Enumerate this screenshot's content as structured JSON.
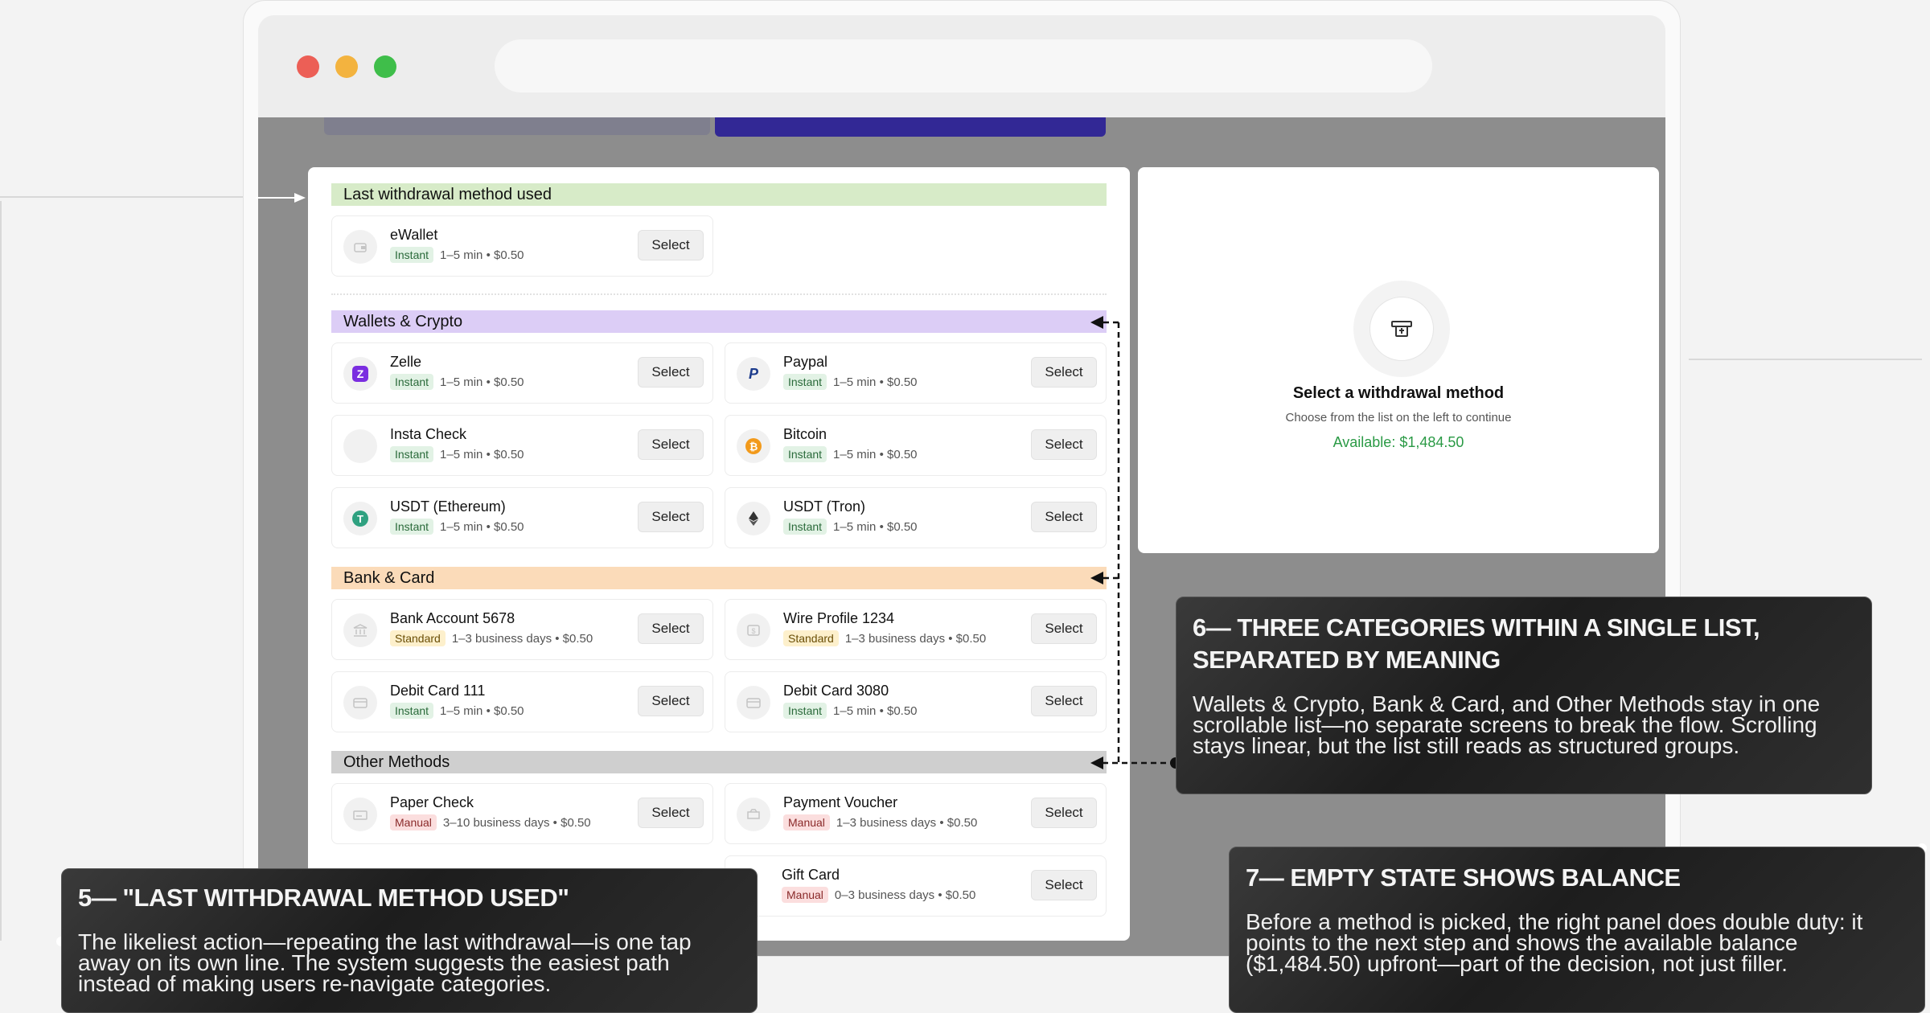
{
  "left_panel": {
    "sections": {
      "last": {
        "label": "Last withdrawal method used"
      },
      "wallets": {
        "label": "Wallets & Crypto"
      },
      "bank": {
        "label": "Bank & Card"
      },
      "other": {
        "label": "Other Methods"
      }
    },
    "select_label": "Select",
    "cards": {
      "ewallet": {
        "name": "eWallet",
        "badge": "Instant",
        "time": "1–5 min • $0.50"
      },
      "zelle": {
        "name": "Zelle",
        "badge": "Instant",
        "time": "1–5 min • $0.50"
      },
      "paypal": {
        "name": "Paypal",
        "badge": "Instant",
        "time": "1–5 min • $0.50"
      },
      "insta_check": {
        "name": "Insta Check",
        "badge": "Instant",
        "time": "1–5 min • $0.50"
      },
      "bitcoin": {
        "name": "Bitcoin",
        "badge": "Instant",
        "time": "1–5 min • $0.50"
      },
      "usdt_eth": {
        "name": "USDT (Ethereum)",
        "badge": "Instant",
        "time": "1–5 min • $0.50"
      },
      "usdt_tron": {
        "name": "USDT (Tron)",
        "badge": "Instant",
        "time": "1–5 min • $0.50"
      },
      "bank_account": {
        "name": "Bank Account 5678",
        "badge": "Standard",
        "time": "1–3 business days • $0.50"
      },
      "wire_profile": {
        "name": "Wire Profile 1234",
        "badge": "Standard",
        "time": "1–3 business days • $0.50"
      },
      "debit_111": {
        "name": "Debit Card 111",
        "badge": "Instant",
        "time": "1–5 min • $0.50"
      },
      "debit_3080": {
        "name": "Debit Card 3080",
        "badge": "Instant",
        "time": "1–5 min • $0.50"
      },
      "paper_check": {
        "name": "Paper Check",
        "badge": "Manual",
        "time": "3–10 business days • $0.50"
      },
      "payment_voucher": {
        "name": "Payment Voucher",
        "badge": "Manual",
        "time": "1–3 business days • $0.50"
      },
      "gift_card": {
        "name": "Gift Card",
        "badge": "Manual",
        "time": "0–3 business days • $0.50"
      }
    }
  },
  "right_panel": {
    "title": "Select a withdrawal method",
    "subtitle": "Choose from the list on the left to continue",
    "balance": "Available: $1,484.50"
  },
  "callouts": {
    "c5": {
      "title": "5— \"LAST WITHDRAWAL METHOD USED\"",
      "body": "The likeliest action—repeating the last withdrawal—is one tap away on its own line. The system suggests the easiest path instead of making users re-navigate categories."
    },
    "c6": {
      "title": "6— THREE CATEGORIES WITHIN A SINGLE LIST, SEPARATED BY MEANING",
      "body": "Wallets & Crypto, Bank & Card, and Other Methods stay in one scrollable list—no separate screens to break the flow. Scrolling stays linear, but the list still reads as structured groups."
    },
    "c7": {
      "title": "7— EMPTY STATE SHOWS BALANCE",
      "body": "Before a method is picked, the right panel does double duty: it points to the next step and shows the available balance ($1,484.50) upfront—part of the decision, not just filler."
    }
  },
  "icons": {
    "zelle": "zelle-icon",
    "paypal": "paypal-icon",
    "bitcoin": "bitcoin-icon",
    "usdt_eth": "tether-icon",
    "usdt_tron": "ethereum-icon",
    "empty_state": "atm-icon"
  },
  "colors": {
    "last_header": "#d7ebc8",
    "wallets_header": "#dccdf6",
    "bank_header": "#fbdbb9",
    "other_header": "#cfcfcf",
    "balance_green": "#2a9a45",
    "instant_badge": "#e2f2e5",
    "standard_badge": "#fdf0cc",
    "manual_badge": "#fbdede"
  }
}
